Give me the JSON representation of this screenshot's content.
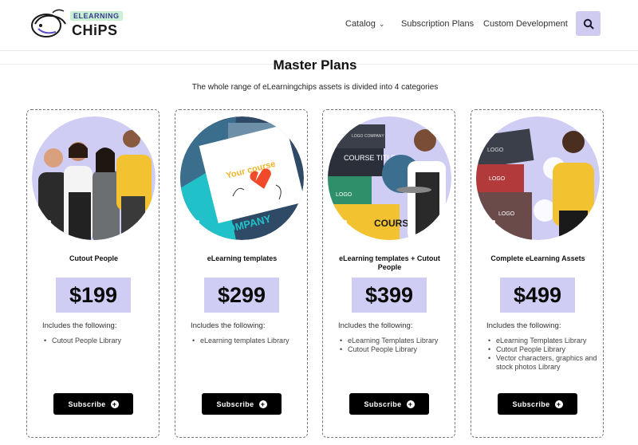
{
  "header": {
    "logo_tag": "ELEARNING",
    "logo_name": "CHiPS",
    "nav": {
      "catalog": "Catalog",
      "subscription_plans": "Subscription Plans",
      "custom_development": "Custom Development"
    },
    "search_icon": "search-icon",
    "accent_color": "#cfcaf0"
  },
  "main": {
    "title": "Master Plans",
    "subtitle": "The whole range of eLearningchips assets is divided into 4 categories"
  },
  "plans": [
    {
      "name": "Cutout People",
      "price": "$199",
      "includes_label": "Includes the following:",
      "features": [
        "Cutout People Library"
      ],
      "button": "Subscribe"
    },
    {
      "name": "eLearning templates",
      "price": "$299",
      "includes_label": "Includes the following:",
      "features": [
        "eLearning templates Library"
      ],
      "button": "Subscribe",
      "image_text": {
        "heading": "Your course",
        "brand": "COMPANY"
      }
    },
    {
      "name": "eLearning templates + Cutout People",
      "price": "$399",
      "includes_label": "Includes the following:",
      "features": [
        "eLearning Templates Library",
        "Cutout People Library"
      ],
      "button": "Subscribe",
      "image_text": {
        "course_title": "COURSE TITLE",
        "company": "LOGO COMPANY",
        "logo": "LOGO",
        "course": "COURSE"
      }
    },
    {
      "name": "Complete eLearning Assets",
      "price": "$499",
      "includes_label": "Includes the following:",
      "features": [
        "eLearning Templates Library",
        "Cutout People Library",
        "Vector characters, graphics and stock photos Library"
      ],
      "button": "Subscribe",
      "image_text": {
        "logo_1": "LOGO",
        "logo_2": "LOGO",
        "logo_3": "LOGO"
      }
    }
  ],
  "colors": {
    "price_bg": "#cfcdf3",
    "button_bg": "#000000",
    "circle_bg": "#cfcdf3"
  }
}
